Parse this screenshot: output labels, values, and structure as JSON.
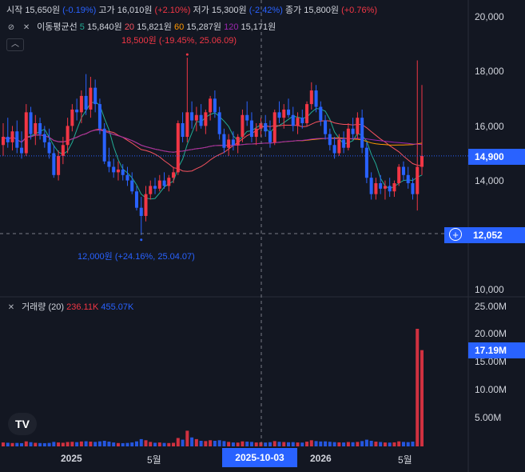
{
  "header": {
    "open_label": "시작",
    "open_value": "15,650원",
    "open_change": "(-0.19%)",
    "high_label": "고가",
    "high_value": "16,010원",
    "high_change": "(+2.10%)",
    "low_label": "저가",
    "low_value": "15,300원",
    "low_change": "(-2.42%)",
    "close_label": "종가",
    "close_value": "15,800원",
    "close_change": "(+0.76%)"
  },
  "ma_legend": {
    "label": "이동평균선",
    "items": [
      {
        "period": "5",
        "value": "15,840원",
        "color": "#22ab94"
      },
      {
        "period": "20",
        "value": "15,821원",
        "color": "#f7525f"
      },
      {
        "period": "60",
        "value": "15,287원",
        "color": "#ff9800"
      },
      {
        "period": "120",
        "value": "15,171원",
        "color": "#9c27b0"
      }
    ]
  },
  "volume_legend": {
    "label": "거래량 (20)",
    "v1": "236.11K",
    "v2": "455.07K"
  },
  "annotations": {
    "high": "18,500원 (-19.45%, 25.06.09)",
    "low": "12,000원 (+24.16%, 25.04.07)"
  },
  "price_axis": {
    "ticks": [
      "20,000",
      "18,000",
      "16,000",
      "14,000",
      "10,000"
    ],
    "last_tag": "14,900",
    "crosshair_tag": "12,052"
  },
  "volume_axis": {
    "ticks": [
      "25.00M",
      "20.00M",
      "15.00M",
      "10.00M",
      "5.00M"
    ],
    "last_tag": "17.19M"
  },
  "x_axis": {
    "ticks": [
      "2025",
      "5월",
      "2026",
      "5월"
    ],
    "crosshair_date": "2025-10-03"
  },
  "colors": {
    "up": "#f23645",
    "down": "#2962ff",
    "background": "#131722",
    "grid": "#1e222d"
  },
  "chart_data": {
    "type": "candlestick",
    "y_axis_price": {
      "range": [
        10000,
        21000
      ],
      "ticks": [
        10000,
        14000,
        16000,
        18000,
        20000
      ]
    },
    "y_axis_volume": {
      "range": [
        0,
        25000000
      ],
      "ticks": [
        5000000,
        10000000,
        15000000,
        20000000,
        25000000
      ]
    },
    "last_price": 14900,
    "crosshair_price": 12052,
    "marked_high": 18500,
    "marked_low": 12000,
    "ohlc": [
      {
        "o": 15300,
        "h": 16100,
        "l": 14900,
        "c": 15600,
        "v": 700000
      },
      {
        "o": 15600,
        "h": 16300,
        "l": 15200,
        "c": 15400,
        "v": 650000
      },
      {
        "o": 15400,
        "h": 16000,
        "l": 15100,
        "c": 15800,
        "v": 600000
      },
      {
        "o": 15800,
        "h": 16200,
        "l": 15000,
        "c": 15200,
        "v": 620000
      },
      {
        "o": 15200,
        "h": 15800,
        "l": 14800,
        "c": 15000,
        "v": 580000
      },
      {
        "o": 15000,
        "h": 16800,
        "l": 14900,
        "c": 16500,
        "v": 900000
      },
      {
        "o": 16500,
        "h": 16700,
        "l": 15500,
        "c": 15700,
        "v": 750000
      },
      {
        "o": 15700,
        "h": 16400,
        "l": 15300,
        "c": 16100,
        "v": 640000
      },
      {
        "o": 16100,
        "h": 16300,
        "l": 15500,
        "c": 15700,
        "v": 600000
      },
      {
        "o": 15700,
        "h": 16000,
        "l": 15200,
        "c": 15400,
        "v": 580000
      },
      {
        "o": 15400,
        "h": 15900,
        "l": 14800,
        "c": 15000,
        "v": 620000
      },
      {
        "o": 15000,
        "h": 15300,
        "l": 14100,
        "c": 14200,
        "v": 800000
      },
      {
        "o": 14200,
        "h": 15100,
        "l": 14000,
        "c": 14900,
        "v": 700000
      },
      {
        "o": 14900,
        "h": 15600,
        "l": 14600,
        "c": 15300,
        "v": 650000
      },
      {
        "o": 15300,
        "h": 16300,
        "l": 15000,
        "c": 16000,
        "v": 780000
      },
      {
        "o": 16000,
        "h": 16800,
        "l": 15800,
        "c": 16600,
        "v": 820000
      },
      {
        "o": 16600,
        "h": 17000,
        "l": 16200,
        "c": 16500,
        "v": 760000
      },
      {
        "o": 16500,
        "h": 17300,
        "l": 16100,
        "c": 17100,
        "v": 880000
      },
      {
        "o": 17100,
        "h": 17900,
        "l": 16400,
        "c": 16600,
        "v": 920000
      },
      {
        "o": 16600,
        "h": 17800,
        "l": 16300,
        "c": 17400,
        "v": 850000
      },
      {
        "o": 17400,
        "h": 17700,
        "l": 16500,
        "c": 16800,
        "v": 800000
      },
      {
        "o": 16800,
        "h": 17000,
        "l": 15700,
        "c": 15900,
        "v": 900000
      },
      {
        "o": 15900,
        "h": 16100,
        "l": 14600,
        "c": 14700,
        "v": 1000000
      },
      {
        "o": 14700,
        "h": 15200,
        "l": 14300,
        "c": 14500,
        "v": 850000
      },
      {
        "o": 14500,
        "h": 14800,
        "l": 14100,
        "c": 14300,
        "v": 700000
      },
      {
        "o": 14300,
        "h": 14700,
        "l": 14000,
        "c": 14400,
        "v": 600000
      },
      {
        "o": 14400,
        "h": 14600,
        "l": 14000,
        "c": 14200,
        "v": 580000
      },
      {
        "o": 14200,
        "h": 14500,
        "l": 13800,
        "c": 14000,
        "v": 620000
      },
      {
        "o": 14000,
        "h": 14300,
        "l": 13500,
        "c": 13600,
        "v": 700000
      },
      {
        "o": 13600,
        "h": 13800,
        "l": 12900,
        "c": 13000,
        "v": 900000
      },
      {
        "o": 13000,
        "h": 13400,
        "l": 12000,
        "c": 12700,
        "v": 1300000
      },
      {
        "o": 12700,
        "h": 13800,
        "l": 12500,
        "c": 13500,
        "v": 1100000
      },
      {
        "o": 13500,
        "h": 14000,
        "l": 13300,
        "c": 13800,
        "v": 800000
      },
      {
        "o": 13800,
        "h": 14100,
        "l": 13500,
        "c": 13700,
        "v": 650000
      },
      {
        "o": 13700,
        "h": 14200,
        "l": 13600,
        "c": 14000,
        "v": 700000
      },
      {
        "o": 14000,
        "h": 14300,
        "l": 13700,
        "c": 13800,
        "v": 620000
      },
      {
        "o": 13800,
        "h": 14200,
        "l": 13600,
        "c": 14100,
        "v": 600000
      },
      {
        "o": 14100,
        "h": 14500,
        "l": 13900,
        "c": 14300,
        "v": 640000
      },
      {
        "o": 14300,
        "h": 16200,
        "l": 14200,
        "c": 16100,
        "v": 1500000
      },
      {
        "o": 16100,
        "h": 16500,
        "l": 15400,
        "c": 15600,
        "v": 1200000
      },
      {
        "o": 15600,
        "h": 18500,
        "l": 15400,
        "c": 16500,
        "v": 2800000
      },
      {
        "o": 16500,
        "h": 16900,
        "l": 15900,
        "c": 16200,
        "v": 1600000
      },
      {
        "o": 16200,
        "h": 16700,
        "l": 15800,
        "c": 16400,
        "v": 1300000
      },
      {
        "o": 16400,
        "h": 16800,
        "l": 15900,
        "c": 16000,
        "v": 1000000
      },
      {
        "o": 16000,
        "h": 16600,
        "l": 15700,
        "c": 16500,
        "v": 950000
      },
      {
        "o": 16500,
        "h": 17100,
        "l": 16200,
        "c": 17000,
        "v": 1100000
      },
      {
        "o": 17000,
        "h": 17300,
        "l": 16300,
        "c": 16500,
        "v": 1000000
      },
      {
        "o": 16500,
        "h": 16700,
        "l": 15500,
        "c": 15700,
        "v": 1100000
      },
      {
        "o": 15700,
        "h": 15900,
        "l": 15000,
        "c": 15200,
        "v": 950000
      },
      {
        "o": 15200,
        "h": 15700,
        "l": 14900,
        "c": 15500,
        "v": 800000
      },
      {
        "o": 15500,
        "h": 15800,
        "l": 15100,
        "c": 15300,
        "v": 700000
      },
      {
        "o": 15300,
        "h": 15700,
        "l": 15000,
        "c": 15600,
        "v": 680000
      },
      {
        "o": 15600,
        "h": 16600,
        "l": 15400,
        "c": 16400,
        "v": 900000
      },
      {
        "o": 16400,
        "h": 16900,
        "l": 16000,
        "c": 16200,
        "v": 850000
      },
      {
        "o": 16200,
        "h": 16500,
        "l": 15400,
        "c": 15600,
        "v": 800000
      },
      {
        "o": 15600,
        "h": 16100,
        "l": 15300,
        "c": 15900,
        "v": 700000
      },
      {
        "o": 15900,
        "h": 16300,
        "l": 15600,
        "c": 16100,
        "v": 720000
      },
      {
        "o": 16100,
        "h": 16400,
        "l": 15600,
        "c": 15800,
        "v": 690000
      },
      {
        "o": 15800,
        "h": 16200,
        "l": 15200,
        "c": 15400,
        "v": 750000
      },
      {
        "o": 15400,
        "h": 16600,
        "l": 15300,
        "c": 16500,
        "v": 950000
      },
      {
        "o": 16500,
        "h": 16900,
        "l": 16100,
        "c": 16300,
        "v": 820000
      },
      {
        "o": 16300,
        "h": 16800,
        "l": 15900,
        "c": 16600,
        "v": 780000
      },
      {
        "o": 16600,
        "h": 17000,
        "l": 16300,
        "c": 16400,
        "v": 740000
      },
      {
        "o": 16400,
        "h": 16700,
        "l": 15800,
        "c": 16000,
        "v": 760000
      },
      {
        "o": 16000,
        "h": 16500,
        "l": 15700,
        "c": 16300,
        "v": 700000
      },
      {
        "o": 16300,
        "h": 16600,
        "l": 15900,
        "c": 16100,
        "v": 680000
      },
      {
        "o": 16100,
        "h": 16900,
        "l": 16000,
        "c": 16800,
        "v": 850000
      },
      {
        "o": 16800,
        "h": 17600,
        "l": 16600,
        "c": 17300,
        "v": 1100000
      },
      {
        "o": 17300,
        "h": 17500,
        "l": 16500,
        "c": 16700,
        "v": 950000
      },
      {
        "o": 16700,
        "h": 16900,
        "l": 16000,
        "c": 16200,
        "v": 880000
      },
      {
        "o": 16200,
        "h": 16400,
        "l": 15500,
        "c": 15700,
        "v": 900000
      },
      {
        "o": 15700,
        "h": 15900,
        "l": 15100,
        "c": 15300,
        "v": 820000
      },
      {
        "o": 15300,
        "h": 15600,
        "l": 14800,
        "c": 15000,
        "v": 760000
      },
      {
        "o": 15000,
        "h": 15700,
        "l": 14900,
        "c": 15500,
        "v": 720000
      },
      {
        "o": 15500,
        "h": 15800,
        "l": 15000,
        "c": 15200,
        "v": 700000
      },
      {
        "o": 15200,
        "h": 16100,
        "l": 15100,
        "c": 15900,
        "v": 780000
      },
      {
        "o": 15900,
        "h": 16300,
        "l": 15500,
        "c": 15700,
        "v": 740000
      },
      {
        "o": 15700,
        "h": 16500,
        "l": 15500,
        "c": 16300,
        "v": 800000
      },
      {
        "o": 16300,
        "h": 16600,
        "l": 15000,
        "c": 15200,
        "v": 950000
      },
      {
        "o": 15200,
        "h": 15400,
        "l": 13900,
        "c": 14100,
        "v": 1200000
      },
      {
        "o": 14100,
        "h": 14300,
        "l": 13300,
        "c": 13500,
        "v": 1000000
      },
      {
        "o": 13500,
        "h": 14100,
        "l": 13300,
        "c": 13900,
        "v": 850000
      },
      {
        "o": 13900,
        "h": 14200,
        "l": 13500,
        "c": 13700,
        "v": 780000
      },
      {
        "o": 13700,
        "h": 14000,
        "l": 13300,
        "c": 13800,
        "v": 700000
      },
      {
        "o": 13800,
        "h": 14100,
        "l": 13400,
        "c": 13600,
        "v": 680000
      },
      {
        "o": 13600,
        "h": 14000,
        "l": 13400,
        "c": 13900,
        "v": 720000
      },
      {
        "o": 13900,
        "h": 14600,
        "l": 13800,
        "c": 14500,
        "v": 900000
      },
      {
        "o": 14500,
        "h": 14700,
        "l": 14000,
        "c": 14200,
        "v": 800000
      },
      {
        "o": 14200,
        "h": 14500,
        "l": 13700,
        "c": 13900,
        "v": 760000
      },
      {
        "o": 13900,
        "h": 14100,
        "l": 13300,
        "c": 13500,
        "v": 850000
      },
      {
        "o": 13500,
        "h": 18400,
        "l": 12900,
        "c": 14500,
        "v": 21000000
      },
      {
        "o": 14500,
        "h": 17500,
        "l": 14200,
        "c": 14900,
        "v": 17190000
      }
    ]
  }
}
